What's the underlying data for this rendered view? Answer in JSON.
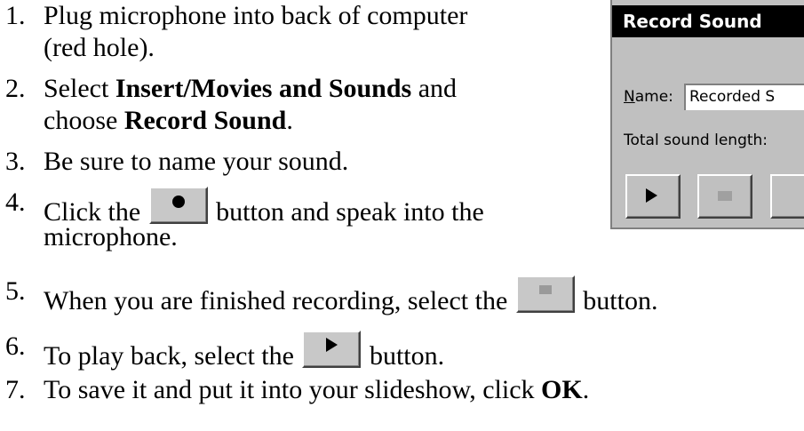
{
  "steps": [
    {
      "num": "1.",
      "lines": [
        [
          "Plug microphone into back of computer"
        ],
        [
          "(red hole)."
        ]
      ]
    },
    {
      "num": "2.",
      "line1_a": "Select ",
      "line1_b": "Insert/Movies and Sounds",
      "line1_c": " and",
      "line2_a": "choose ",
      "line2_b": "Record Sound",
      "line2_c": "."
    },
    {
      "num": "3.",
      "text": "Be sure to name your sound."
    },
    {
      "num": "4.",
      "text_a": "Click the",
      "text_b": "button and speak into the",
      "line2": "microphone."
    },
    {
      "num": "5.",
      "text_a": "When you are finished recording, select the",
      "text_b": "button."
    },
    {
      "num": "6.",
      "text_a": "To play back, select the",
      "text_b": "button."
    },
    {
      "num": "7.",
      "text_a": "To save it and put it into your slideshow, click ",
      "text_b": "OK",
      "text_c": "."
    }
  ],
  "step1_line1": "Plug microphone into back of computer",
  "step1_line2": "(red hole).",
  "dialog": {
    "title": "Record Sound",
    "name_label": "Name:",
    "name_value": "Recorded S",
    "length_label": "Total sound length:"
  },
  "icons": [
    "record-icon",
    "stop-icon",
    "play-icon"
  ]
}
